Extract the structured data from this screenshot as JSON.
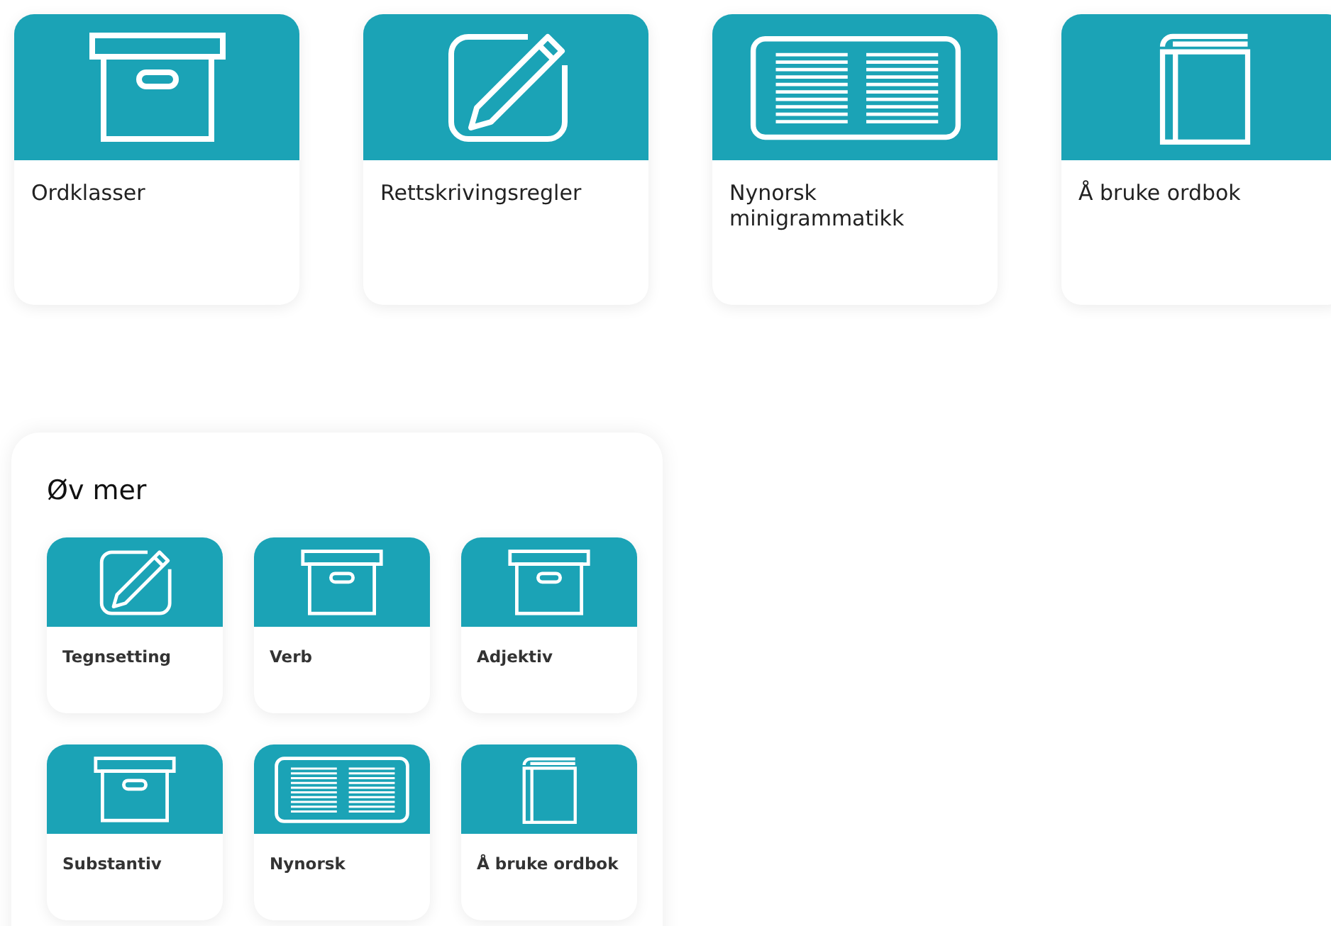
{
  "cards": [
    {
      "title": "Ordklasser",
      "kind": "box"
    },
    {
      "title": "Rettskrivingsregler",
      "kind": "pencil"
    },
    {
      "title": "Nynorsk minigrammatikk",
      "kind": "pages"
    },
    {
      "title": "Å bruke ordbok",
      "kind": "book"
    }
  ],
  "practice": {
    "heading": "Øv mer",
    "cards": [
      {
        "title": "Tegnsetting",
        "kind": "pencil"
      },
      {
        "title": "Verb",
        "kind": "box"
      },
      {
        "title": "Adjektiv",
        "kind": "box"
      },
      {
        "title": "Substantiv",
        "kind": "box"
      },
      {
        "title": "Nynorsk",
        "kind": "pages"
      },
      {
        "title": "Å bruke ordbok",
        "kind": "book"
      }
    ]
  }
}
